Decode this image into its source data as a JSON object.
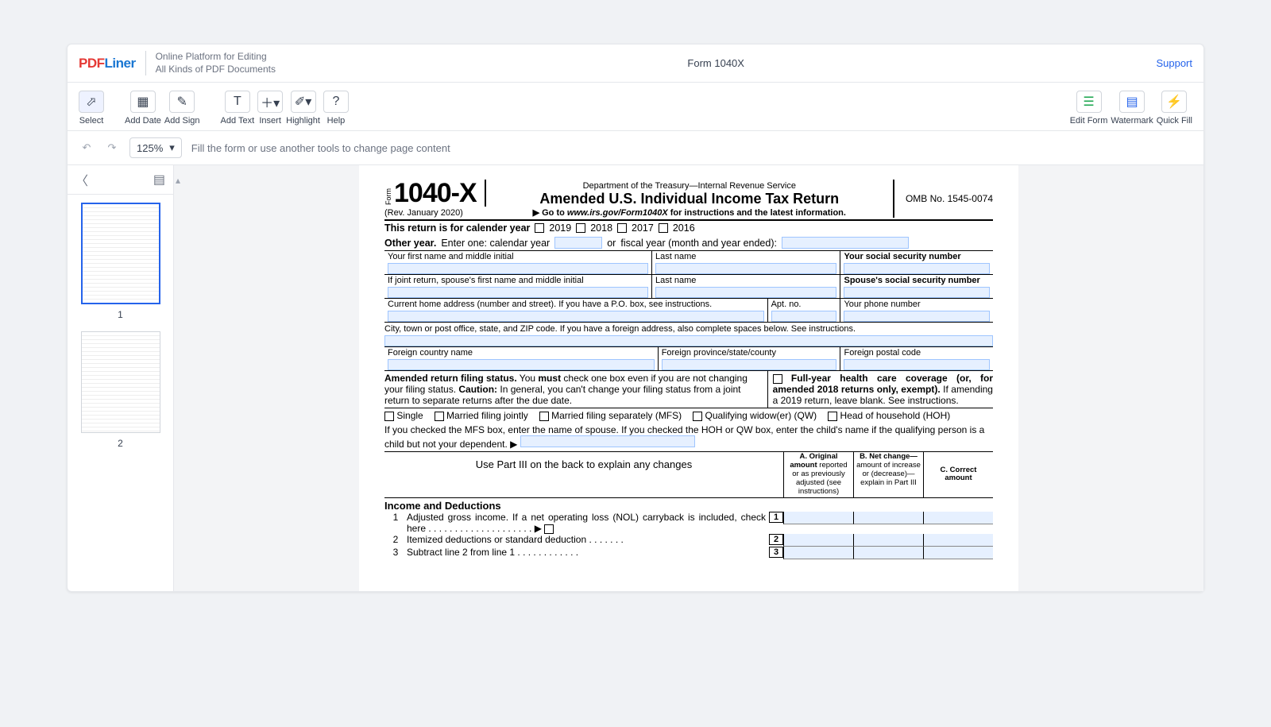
{
  "brand": {
    "p1": "PDF",
    "p2": "Liner"
  },
  "tagline": {
    "l1": "Online Platform for Editing",
    "l2": "All Kinds of PDF Documents"
  },
  "doc_title": "Form 1040X",
  "support": "Support",
  "tools": {
    "select": "Select",
    "add_date": "Add Date",
    "add_sign": "Add Sign",
    "add_text": "Add Text",
    "insert": "Insert",
    "highlight": "Highlight",
    "help": "Help",
    "edit_form": "Edit Form",
    "watermark": "Watermark",
    "quick_fill": "Quick Fill"
  },
  "subbar": {
    "zoom": "125%",
    "hint": "Fill the form or use another tools to change page content"
  },
  "thumbs": {
    "p1": "1",
    "p2": "2"
  },
  "form": {
    "form_word": "Form",
    "form_no": "1040-X",
    "rev": "(Rev. January 2020)",
    "dept": "Department of the Treasury—Internal Revenue Service",
    "title": "Amended U.S. Individual Income Tax Return",
    "goto_prefix": "▶ Go to ",
    "goto_url": "www.irs.gov/Form1040X",
    "goto_suffix": " for instructions and the latest information.",
    "omb": "OMB No. 1545-0074",
    "cal_year_label": "This return is for calender year",
    "years": {
      "y1": "2019",
      "y2": "2018",
      "y3": "2017",
      "y4": "2016"
    },
    "other_year_label": "Other year.",
    "other_year_text": " Enter one: calendar year ",
    "or": "or",
    "fiscal_label": " fiscal year (month and year ended): ",
    "fields": {
      "first_name": "Your first name and middle initial",
      "last_name": "Last name",
      "ssn": "Your social security number",
      "sp_first": "If joint return, spouse's first name and middle initial",
      "sp_last": "Last name",
      "sp_ssn": "Spouse's social security number",
      "address": "Current home address (number and street). If you have a P.O. box, see instructions.",
      "apt": "Apt. no.",
      "phone": "Your phone number",
      "city_note": "City, town or post office, state, and ZIP code. If you have a foreign address, also complete spaces below. See instructions.",
      "f_country": "Foreign country name",
      "f_province": "Foreign province/state/county",
      "f_postal": "Foreign postal code"
    },
    "status": {
      "head": "Amended return filing status.",
      "text1": " You ",
      "must": "must",
      "text2": " check one box even if you are not changing your filing status. ",
      "caution": "Caution:",
      "text3": " In general, you can't change your filing status from a joint return to separate returns after the due date.",
      "hc_bold": "Full-year health care coverage (or, for amended 2018 returns only, exempt).",
      "hc_rest": " If amending a 2019 return, leave blank. See instructions.",
      "opts": {
        "single": "Single",
        "mfj": "Married filing jointly",
        "mfs": "Married filing separately (MFS)",
        "qw": "Qualifying widow(er) (QW)",
        "hoh": "Head of household (HOH)"
      },
      "mfs_note": "If you checked the MFS box, enter the name of spouse. If you checked the HOH or QW box, enter the child's name if the qualifying person is a child but not your dependent. ▶"
    },
    "cols": {
      "explain": "Use Part III on the back to explain any changes",
      "a_head": "A. Original amount",
      "a_rest": " reported or as previously adjusted (see instructions)",
      "b_head": "B. Net change—",
      "b_rest": "amount of increase or (decrease)—explain in Part III",
      "c_head": "C. Correct amount"
    },
    "income": {
      "head": "Income and Deductions",
      "l1_no": "1",
      "l1": "Adjusted gross income. If a net operating loss (NOL) carryback is included, check here  .  .  .  .  .  .  .  .  .  .  .  .  .  .  .  .  .  .  .  . ▶",
      "l2_no": "2",
      "l2": "Itemized deductions or standard deduction    .     .     .     .     .     .     .",
      "l3_no": "3",
      "l3": "Subtract line 2 from line 1    .     .     .     .     .     .     .     .     .     .     .     ."
    }
  }
}
